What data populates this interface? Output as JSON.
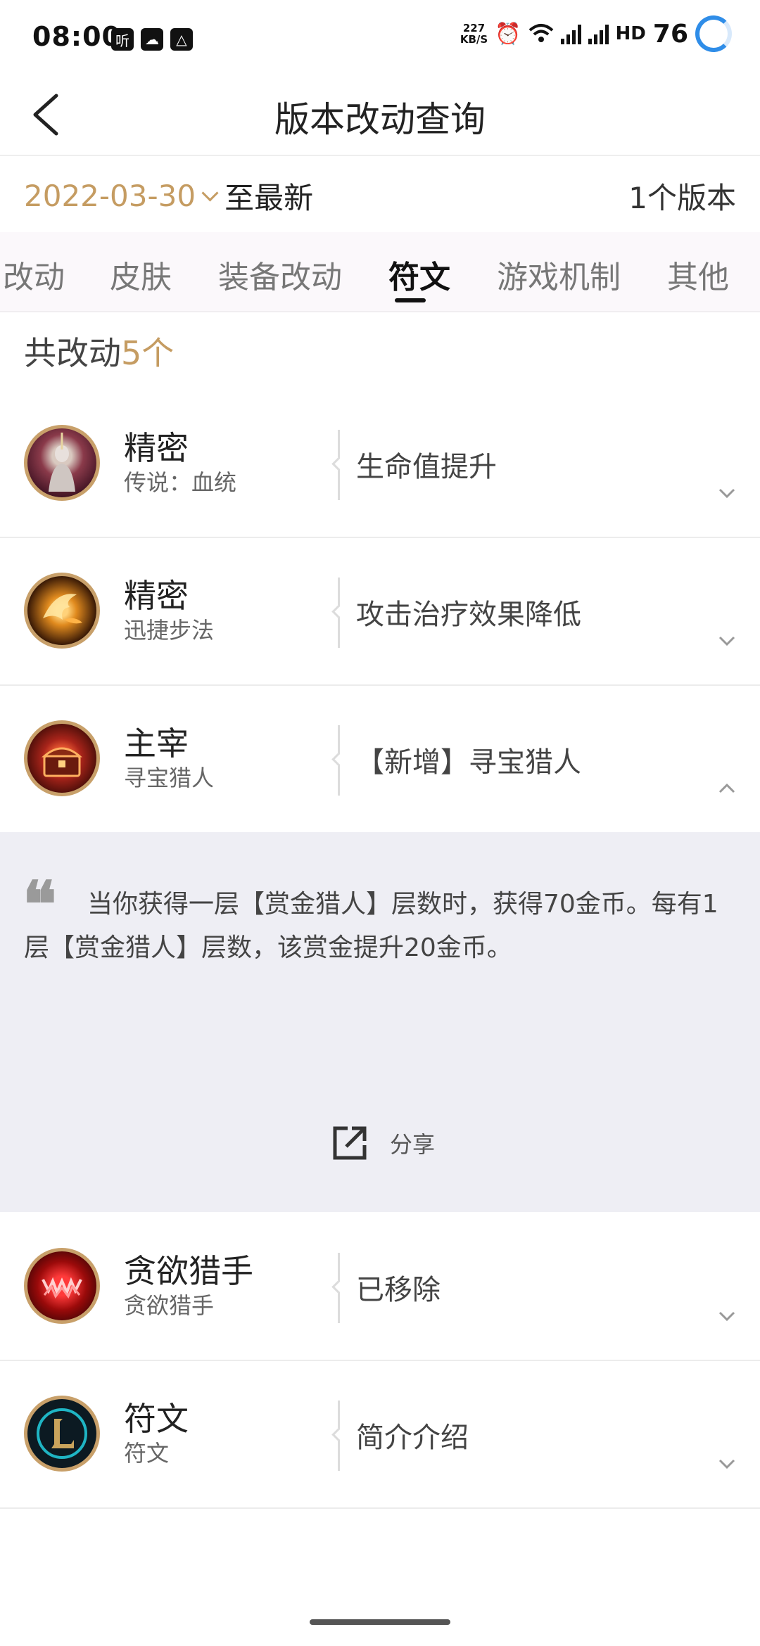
{
  "status_bar": {
    "time": "08:00",
    "apps": [
      "听",
      "☁",
      "△"
    ],
    "net_speed_value": "227",
    "net_speed_unit": "KB/S",
    "hd": "HD",
    "battery": "76"
  },
  "header": {
    "title": "版本改动查询"
  },
  "filter": {
    "date": "2022-03-30",
    "to_label": "至最新",
    "version_count": "1个版本"
  },
  "tabs": [
    {
      "label": "改动"
    },
    {
      "label": "皮肤"
    },
    {
      "label": "装备改动"
    },
    {
      "label": "符文"
    },
    {
      "label": "游戏机制"
    },
    {
      "label": "其他"
    }
  ],
  "summary": {
    "prefix": "共改动",
    "count": "5个"
  },
  "changes": [
    {
      "title": "精密",
      "subtitle": "传说：血统",
      "desc": "生命值提升",
      "icon": "legend-bloodline-icon"
    },
    {
      "title": "精密",
      "subtitle": "迅捷步法",
      "desc": "攻击治疗效果降低",
      "icon": "fleet-footwork-icon"
    },
    {
      "title": "主宰",
      "subtitle": "寻宝猎人",
      "desc": "【新增】寻宝猎人",
      "icon": "treasure-hunter-icon"
    },
    {
      "title": "贪欲猎手",
      "subtitle": "贪欲猎手",
      "desc": "已移除",
      "icon": "ravenous-hunter-icon"
    },
    {
      "title": "符文",
      "subtitle": "符文",
      "desc": "简介介绍",
      "icon": "lol-logo-icon"
    }
  ],
  "detail": {
    "quote_glyph": "❝",
    "text": "当你获得一层【赏金猎人】层数时，获得70金币。每有1层【赏金猎人】层数，该赏金提升20金币。",
    "share_label": "分享"
  },
  "colors": {
    "accent": "#c59c62",
    "panel": "#eeeef4",
    "progress_ring": "#2f8de8"
  }
}
